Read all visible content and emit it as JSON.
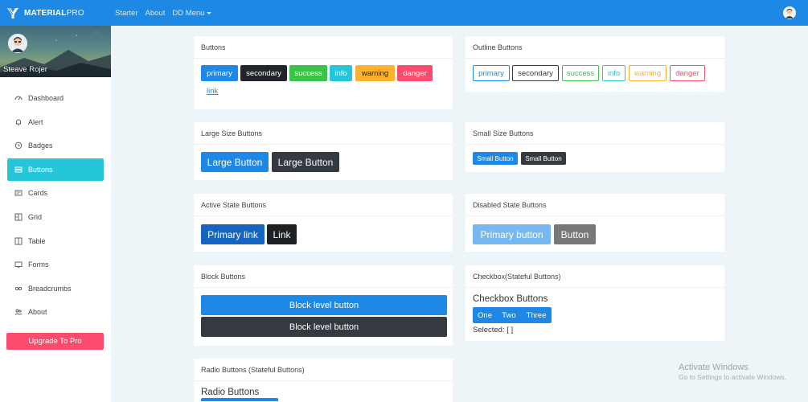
{
  "brand": {
    "name_bold": "MATERIAL",
    "name_light": "PRO"
  },
  "nav": {
    "starter": "Starter",
    "about": "About",
    "dd_menu": "DD Menu"
  },
  "profile": {
    "name": "Steave Rojer"
  },
  "sidebar": {
    "items": [
      {
        "label": "Dashboard",
        "icon": "speedometer-icon"
      },
      {
        "label": "Alert",
        "icon": "bell-icon"
      },
      {
        "label": "Badges",
        "icon": "clock-icon"
      },
      {
        "label": "Buttons",
        "icon": "list-icon",
        "active": true
      },
      {
        "label": "Cards",
        "icon": "card-icon"
      },
      {
        "label": "Grid",
        "icon": "grid-icon"
      },
      {
        "label": "Table",
        "icon": "table-icon"
      },
      {
        "label": "Forms",
        "icon": "form-icon"
      },
      {
        "label": "Breadcrumbs",
        "icon": "link-icon"
      },
      {
        "label": "About",
        "icon": "people-icon"
      }
    ],
    "upgrade": "Upgrade To Pro"
  },
  "cards": {
    "buttons": {
      "title": "Buttons",
      "primary": "primary",
      "secondary": "secondary",
      "success": "success",
      "info": "info",
      "warning": "warning",
      "danger": "danger",
      "link": "link"
    },
    "outline": {
      "title": "Outline Buttons",
      "primary": "primary",
      "secondary": "secondary",
      "success": "success",
      "info": "info",
      "warning": "warning",
      "danger": "danger"
    },
    "large": {
      "title": "Large Size Buttons",
      "btn1": "Large Button",
      "btn2": "Large Button"
    },
    "small": {
      "title": "Small Size Buttons",
      "btn1": "Small Button",
      "btn2": "Small Button"
    },
    "active": {
      "title": "Active State Buttons",
      "btn1": "Primary link",
      "btn2": "Link"
    },
    "disabled": {
      "title": "Disabled State Buttons",
      "btn1": "Primary button",
      "btn2": "Button"
    },
    "block": {
      "title": "Block Buttons",
      "btn1": "Block level button",
      "btn2": "Block level button"
    },
    "checkbox": {
      "title": "Checkbox(Stateful Buttons)",
      "heading": "Checkbox Buttons",
      "options": [
        "One",
        "Two",
        "Three"
      ],
      "selected": "Selected: [ ]"
    },
    "radio": {
      "title": "Radio Buttons (Stateful Buttons)",
      "heading": "Radio Buttons"
    }
  },
  "watermark": {
    "line1": "Activate Windows",
    "line2": "Go to Settings to activate Windows."
  },
  "colors": {
    "topbar": "#1e88e5",
    "active": "#26c6da",
    "danger": "#fc4b6c"
  }
}
